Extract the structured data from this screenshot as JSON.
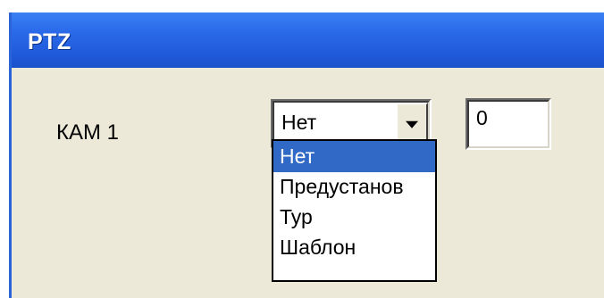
{
  "window": {
    "title": "PTZ"
  },
  "row": {
    "camera_label": "КАМ 1",
    "mode_select": {
      "value": "Нет",
      "options": [
        "Нет",
        "Предустанов",
        "Тур",
        "Шаблон"
      ],
      "selected_index": 0
    },
    "number_value": "0"
  },
  "icons": {
    "dropdown_arrow": "chevron-down-icon"
  },
  "colors": {
    "titlebar": "#2a6ae9",
    "selection": "#3169c6",
    "window_bg": "#ece9d8"
  }
}
